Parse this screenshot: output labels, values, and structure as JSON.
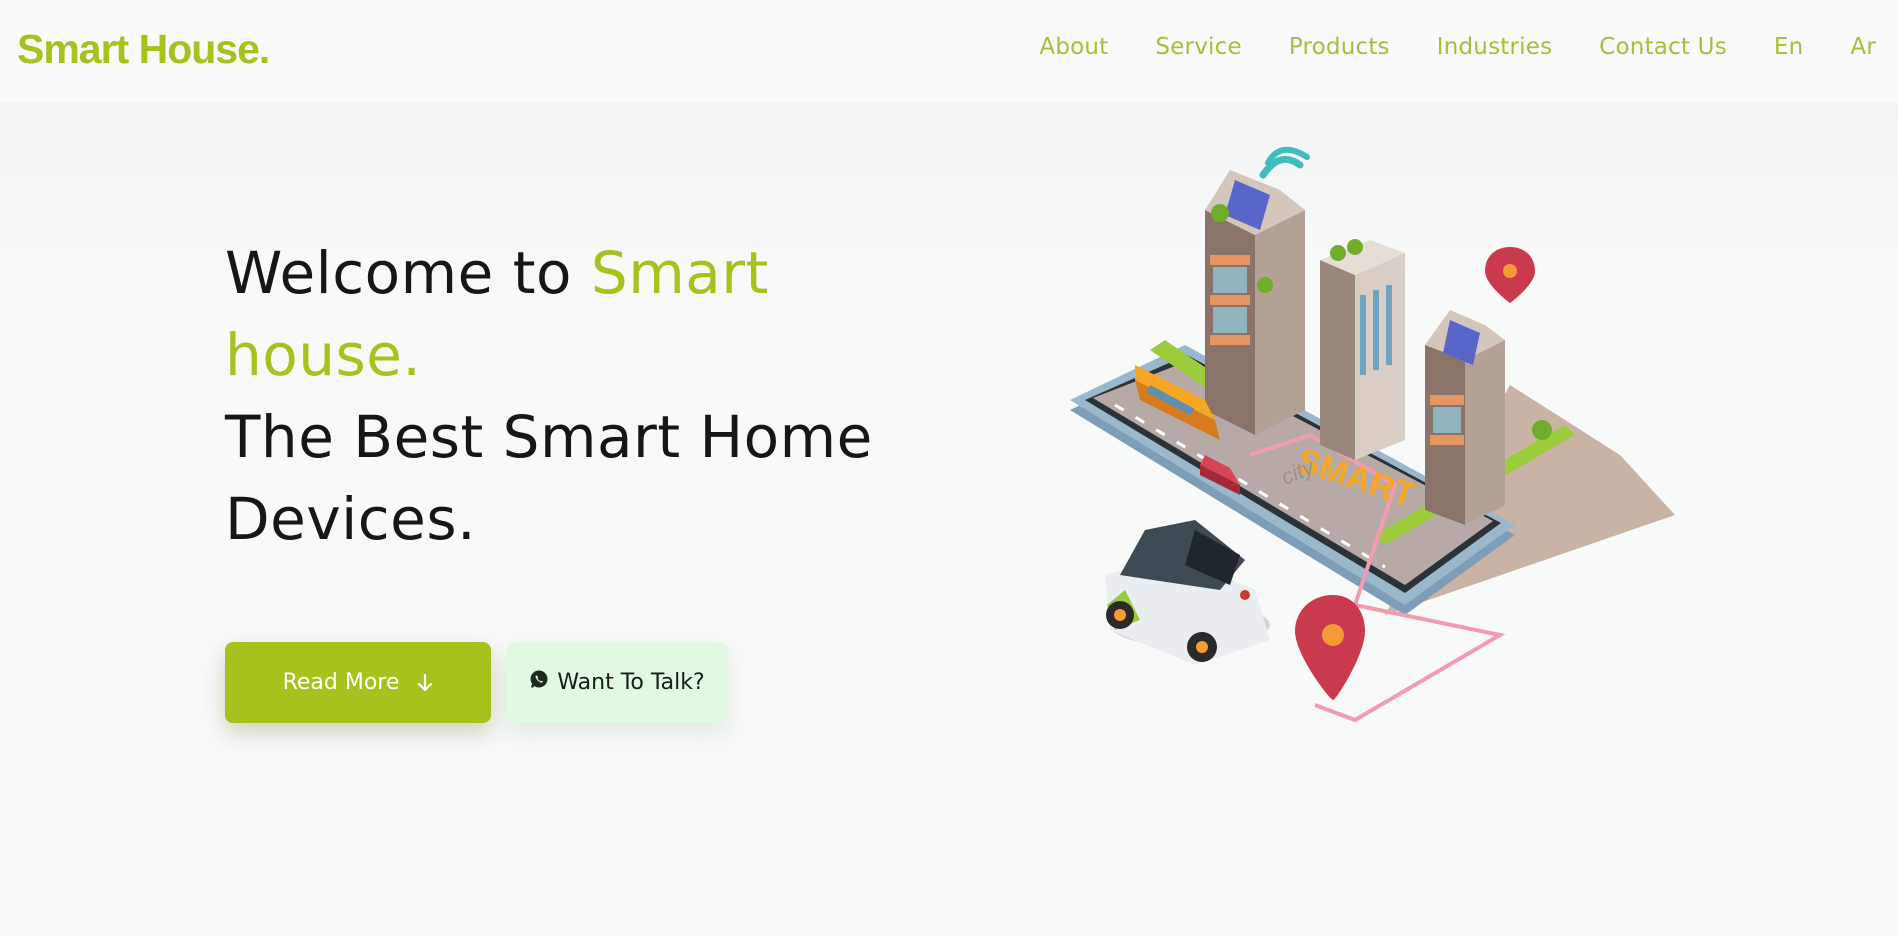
{
  "brand": {
    "logo": "Smart House."
  },
  "nav": {
    "items": [
      "About",
      "Service",
      "Products",
      "Industries",
      "Contact Us",
      "En",
      "Ar"
    ]
  },
  "hero": {
    "welcome_prefix": "Welcome to ",
    "welcome_accent_1": "Smart",
    "welcome_accent_2": "house.",
    "tagline_1": "The Best Smart Home",
    "tagline_2": "Devices.",
    "primary_button": "Read More",
    "secondary_button": "Want To Talk?"
  },
  "illustration": {
    "sign_text": "SMART",
    "sign_subtext": "city"
  },
  "colors": {
    "accent": "#a8c11c",
    "nav_text": "#a1c13a",
    "secondary_button_bg": "#e1f9e3",
    "page_bg": "#f8f9f9"
  }
}
